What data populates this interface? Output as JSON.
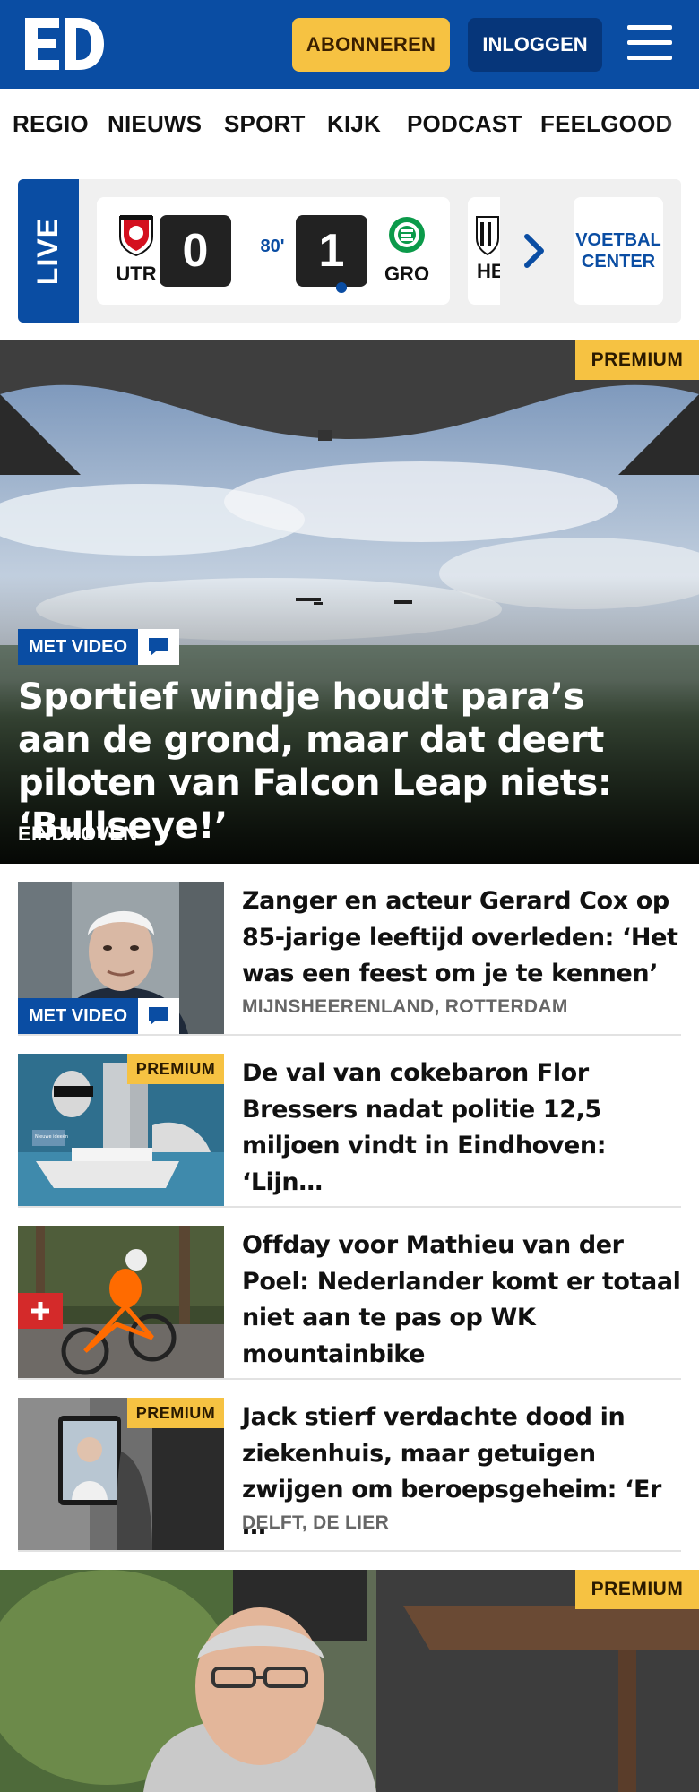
{
  "header": {
    "logo_text": "ED",
    "subscribe_label": "ABONNEREN",
    "login_label": "INLOGGEN",
    "menu_icon": "hamburger-menu-icon",
    "brand_color": "#0a4da3",
    "accent_color": "#f6c242"
  },
  "nav": {
    "items": [
      "REGIO",
      "NIEUWS",
      "SPORT",
      "KIJK",
      "PODCAST",
      "FEELGOOD"
    ]
  },
  "live": {
    "label": "LIVE",
    "match": {
      "home_abbr": "UTR",
      "away_abbr": "GRO",
      "home_score": "0",
      "away_score": "1",
      "minute": "80'"
    },
    "next_match_abbr": "HE",
    "voetbal_center_label": "VOETBAL CENTER"
  },
  "hero": {
    "premium_label": "PREMIUM",
    "video_label": "MET VIDEO",
    "title": "Sportief windje houdt para’s aan de grond, maar dat deert piloten van Falcon Leap niets: ‘Bullseye!’",
    "location": "EINDHOVEN"
  },
  "articles": [
    {
      "title": "Zanger en acteur Gerard Cox op 85-jarige leeftijd overleden: ‘Het was een feest om je te kennen’",
      "location": "MIJNSHEERENLAND, ROTTERDAM",
      "video_label": "MET VIDEO"
    },
    {
      "title": "De val van cokebaron Flor Bressers nadat politie 12,5 miljoen vindt in Eindhoven: ‘Lijn…",
      "premium_label": "PREMIUM",
      "thumb_caption": "Nieuwe ideeën"
    },
    {
      "title": "Offday voor Mathieu van der Poel: Nederlander komt er totaal niet aan te pas op WK mountainbike"
    },
    {
      "title": "Jack stierf verdachte dood in ziekenhuis, maar getuigen zwijgen om beroepsgeheim: ‘Er …",
      "location": "DELFT, DE LIER",
      "premium_label": "PREMIUM"
    }
  ],
  "bottom_hero": {
    "premium_label": "PREMIUM"
  }
}
